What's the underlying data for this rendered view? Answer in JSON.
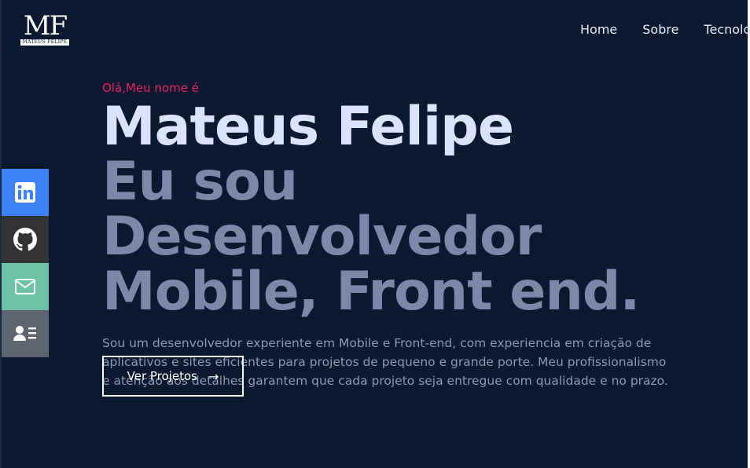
{
  "logo": {
    "mark": "MF",
    "subtitle": "MATEUS FELIPE"
  },
  "nav": {
    "items": [
      "Home",
      "Sobre",
      "Tecnologias"
    ]
  },
  "social": [
    {
      "name": "linkedin",
      "icon": "linkedin-icon",
      "color": "#3b82f6"
    },
    {
      "name": "github",
      "icon": "github-icon",
      "color": "#333333"
    },
    {
      "name": "email",
      "icon": "mail-icon",
      "color": "#6cc3a7"
    },
    {
      "name": "resume",
      "icon": "contact-card-icon",
      "color": "#5d6570"
    }
  ],
  "hero": {
    "greeting": "Olá,Meu nome é",
    "name": "Mateus Felipe",
    "role_line1": "Eu sou Desenvolvedor",
    "role_line2": "Mobile, Front end.",
    "description": "Sou um desenvolvedor experiente em Mobile e Front-end, com experiencia em criação de aplicativos e sites eficientes para projetos de pequeno e grande porte. Meu profissionalismo e atenção aos detalhes garantem que cada projeto seja entregue com qualidade e no prazo.",
    "cta_label": "Ver Projetos",
    "cta_arrow": "→"
  },
  "colors": {
    "background": "#0a1930",
    "accent": "#e5245f",
    "name": "#dbe4ff",
    "role": "#7c87aa"
  }
}
